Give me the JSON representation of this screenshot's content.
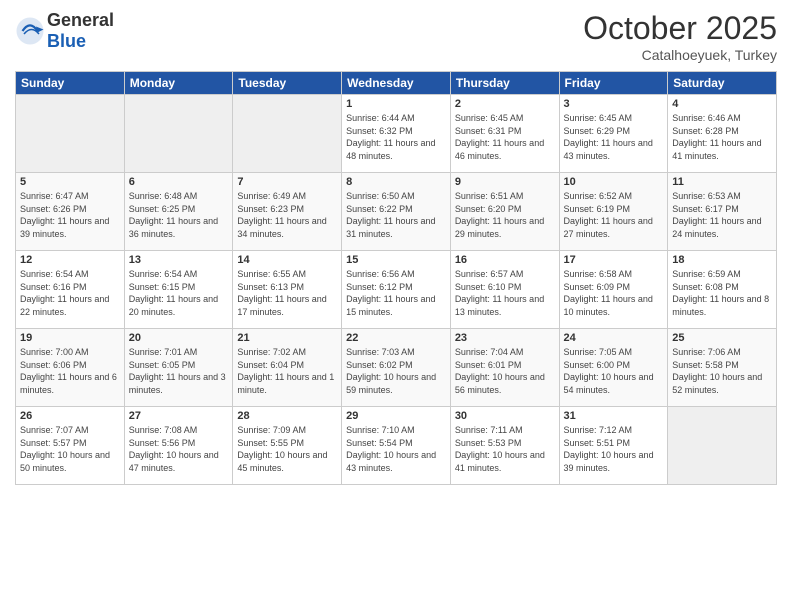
{
  "header": {
    "logo_general": "General",
    "logo_blue": "Blue",
    "month_title": "October 2025",
    "location": "Catalhoeyuek, Turkey"
  },
  "weekdays": [
    "Sunday",
    "Monday",
    "Tuesday",
    "Wednesday",
    "Thursday",
    "Friday",
    "Saturday"
  ],
  "weeks": [
    [
      {
        "day": "",
        "empty": true
      },
      {
        "day": "",
        "empty": true
      },
      {
        "day": "",
        "empty": true
      },
      {
        "day": "1",
        "sunrise": "6:44 AM",
        "sunset": "6:32 PM",
        "daylight": "11 hours and 48 minutes."
      },
      {
        "day": "2",
        "sunrise": "6:45 AM",
        "sunset": "6:31 PM",
        "daylight": "11 hours and 46 minutes."
      },
      {
        "day": "3",
        "sunrise": "6:45 AM",
        "sunset": "6:29 PM",
        "daylight": "11 hours and 43 minutes."
      },
      {
        "day": "4",
        "sunrise": "6:46 AM",
        "sunset": "6:28 PM",
        "daylight": "11 hours and 41 minutes."
      }
    ],
    [
      {
        "day": "5",
        "sunrise": "6:47 AM",
        "sunset": "6:26 PM",
        "daylight": "11 hours and 39 minutes."
      },
      {
        "day": "6",
        "sunrise": "6:48 AM",
        "sunset": "6:25 PM",
        "daylight": "11 hours and 36 minutes."
      },
      {
        "day": "7",
        "sunrise": "6:49 AM",
        "sunset": "6:23 PM",
        "daylight": "11 hours and 34 minutes."
      },
      {
        "day": "8",
        "sunrise": "6:50 AM",
        "sunset": "6:22 PM",
        "daylight": "11 hours and 31 minutes."
      },
      {
        "day": "9",
        "sunrise": "6:51 AM",
        "sunset": "6:20 PM",
        "daylight": "11 hours and 29 minutes."
      },
      {
        "day": "10",
        "sunrise": "6:52 AM",
        "sunset": "6:19 PM",
        "daylight": "11 hours and 27 minutes."
      },
      {
        "day": "11",
        "sunrise": "6:53 AM",
        "sunset": "6:17 PM",
        "daylight": "11 hours and 24 minutes."
      }
    ],
    [
      {
        "day": "12",
        "sunrise": "6:54 AM",
        "sunset": "6:16 PM",
        "daylight": "11 hours and 22 minutes."
      },
      {
        "day": "13",
        "sunrise": "6:54 AM",
        "sunset": "6:15 PM",
        "daylight": "11 hours and 20 minutes."
      },
      {
        "day": "14",
        "sunrise": "6:55 AM",
        "sunset": "6:13 PM",
        "daylight": "11 hours and 17 minutes."
      },
      {
        "day": "15",
        "sunrise": "6:56 AM",
        "sunset": "6:12 PM",
        "daylight": "11 hours and 15 minutes."
      },
      {
        "day": "16",
        "sunrise": "6:57 AM",
        "sunset": "6:10 PM",
        "daylight": "11 hours and 13 minutes."
      },
      {
        "day": "17",
        "sunrise": "6:58 AM",
        "sunset": "6:09 PM",
        "daylight": "11 hours and 10 minutes."
      },
      {
        "day": "18",
        "sunrise": "6:59 AM",
        "sunset": "6:08 PM",
        "daylight": "11 hours and 8 minutes."
      }
    ],
    [
      {
        "day": "19",
        "sunrise": "7:00 AM",
        "sunset": "6:06 PM",
        "daylight": "11 hours and 6 minutes."
      },
      {
        "day": "20",
        "sunrise": "7:01 AM",
        "sunset": "6:05 PM",
        "daylight": "11 hours and 3 minutes."
      },
      {
        "day": "21",
        "sunrise": "7:02 AM",
        "sunset": "6:04 PM",
        "daylight": "11 hours and 1 minute."
      },
      {
        "day": "22",
        "sunrise": "7:03 AM",
        "sunset": "6:02 PM",
        "daylight": "10 hours and 59 minutes."
      },
      {
        "day": "23",
        "sunrise": "7:04 AM",
        "sunset": "6:01 PM",
        "daylight": "10 hours and 56 minutes."
      },
      {
        "day": "24",
        "sunrise": "7:05 AM",
        "sunset": "6:00 PM",
        "daylight": "10 hours and 54 minutes."
      },
      {
        "day": "25",
        "sunrise": "7:06 AM",
        "sunset": "5:58 PM",
        "daylight": "10 hours and 52 minutes."
      }
    ],
    [
      {
        "day": "26",
        "sunrise": "7:07 AM",
        "sunset": "5:57 PM",
        "daylight": "10 hours and 50 minutes."
      },
      {
        "day": "27",
        "sunrise": "7:08 AM",
        "sunset": "5:56 PM",
        "daylight": "10 hours and 47 minutes."
      },
      {
        "day": "28",
        "sunrise": "7:09 AM",
        "sunset": "5:55 PM",
        "daylight": "10 hours and 45 minutes."
      },
      {
        "day": "29",
        "sunrise": "7:10 AM",
        "sunset": "5:54 PM",
        "daylight": "10 hours and 43 minutes."
      },
      {
        "day": "30",
        "sunrise": "7:11 AM",
        "sunset": "5:53 PM",
        "daylight": "10 hours and 41 minutes."
      },
      {
        "day": "31",
        "sunrise": "7:12 AM",
        "sunset": "5:51 PM",
        "daylight": "10 hours and 39 minutes."
      },
      {
        "day": "",
        "empty": true
      }
    ]
  ],
  "labels": {
    "sunrise_prefix": "Sunrise: ",
    "sunset_prefix": "Sunset: ",
    "daylight_label": "Daylight: "
  }
}
